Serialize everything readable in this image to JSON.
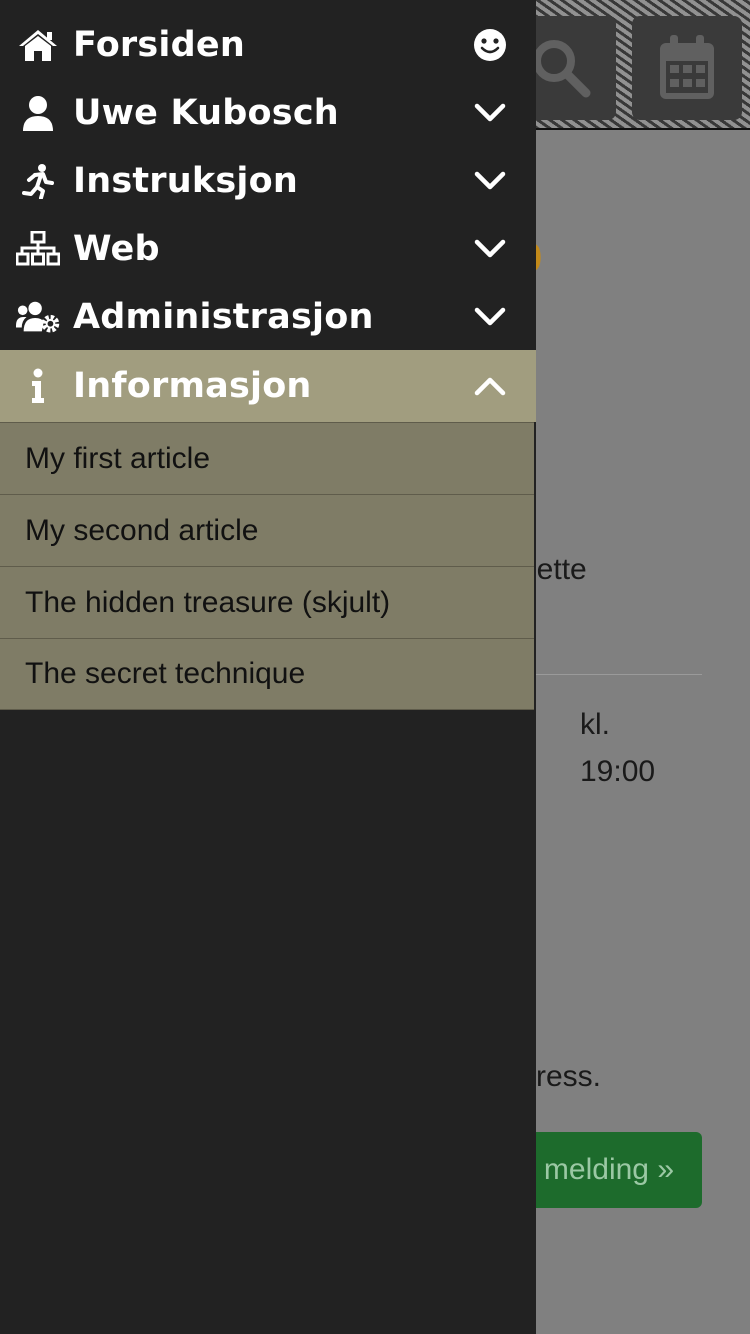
{
  "menu": {
    "items": [
      {
        "label": "Forsiden",
        "icon": "home-icon",
        "trailing": "smiley-icon"
      },
      {
        "label": "Uwe Kubosch",
        "icon": "user-icon",
        "trailing": "chevron-down-icon"
      },
      {
        "label": "Instruksjon",
        "icon": "running-icon",
        "trailing": "chevron-down-icon"
      },
      {
        "label": "Web",
        "icon": "sitemap-icon",
        "trailing": "chevron-down-icon"
      },
      {
        "label": "Administrasjon",
        "icon": "users-cog-icon",
        "trailing": "chevron-down-icon"
      },
      {
        "label": "Informasjon",
        "icon": "info-icon",
        "trailing": "chevron-up-icon",
        "expanded": true
      }
    ],
    "sub_items": [
      {
        "label": "My first article"
      },
      {
        "label": "My second article"
      },
      {
        "label": "The hidden treasure (skjult)"
      },
      {
        "label": "The secret technique"
      }
    ]
  },
  "background": {
    "header_buttons": [
      "search-icon",
      "calendar-icon"
    ],
    "orange_fragment": "0",
    "text_fragment_1": "dette",
    "time_label": "kl.",
    "time_value": "19:00",
    "text_fragment_2": "ress.",
    "button_label": "melding »"
  },
  "colors": {
    "drawer_bg": "#222222",
    "active_item_bg": "#a19d7f",
    "sub_item_bg": "#7f7c66",
    "accent_green": "#1d6b2c",
    "accent_orange": "#c38a1a"
  }
}
